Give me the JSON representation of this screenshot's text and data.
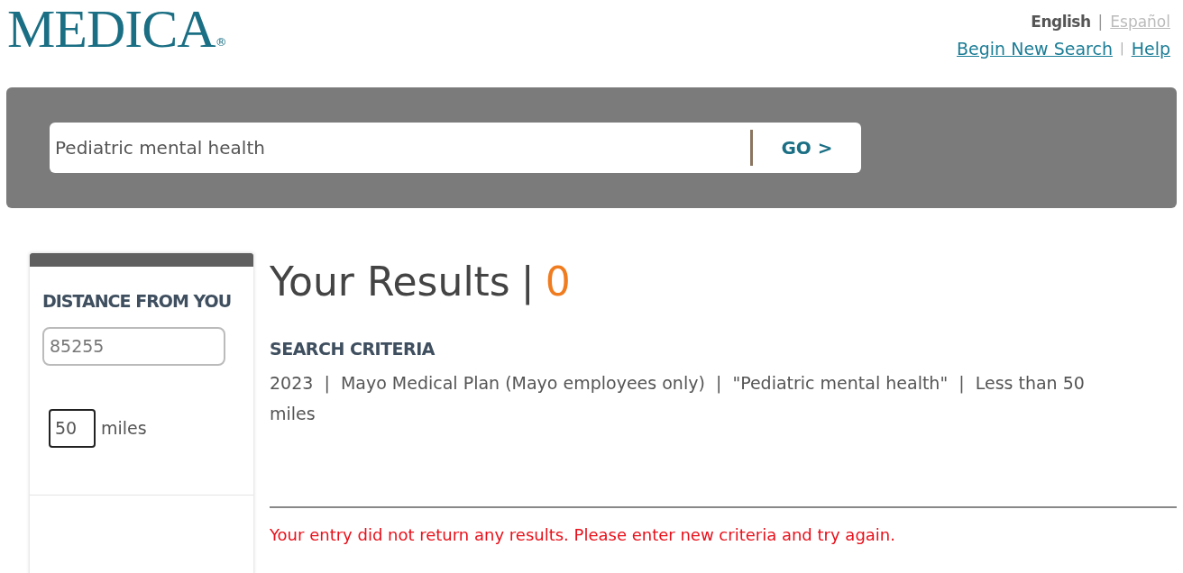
{
  "logo": {
    "text": "MEDICA",
    "mark": "®"
  },
  "languages": {
    "separator": "|",
    "items": [
      {
        "label": "English",
        "selected": true
      },
      {
        "label": "Español",
        "selected": false
      }
    ]
  },
  "header_links": {
    "separator": "|",
    "items": [
      "Begin New Search",
      "Help"
    ]
  },
  "search": {
    "value": "Pediatric mental health",
    "button": "GO >"
  },
  "filter": {
    "title": "DISTANCE FROM YOU",
    "zip": "85255",
    "miles_value": "50",
    "miles_label": "miles"
  },
  "results": {
    "title": "Your Results",
    "separator": "|",
    "count": "0",
    "criteria_title": "SEARCH CRITERIA",
    "criteria": "2023  |  Mayo Medical Plan (Mayo employees only)  |  \"Pediatric mental health\"  |  Less than 50 miles",
    "message": "Your entry did not return any results. Please enter new criteria and try again."
  }
}
